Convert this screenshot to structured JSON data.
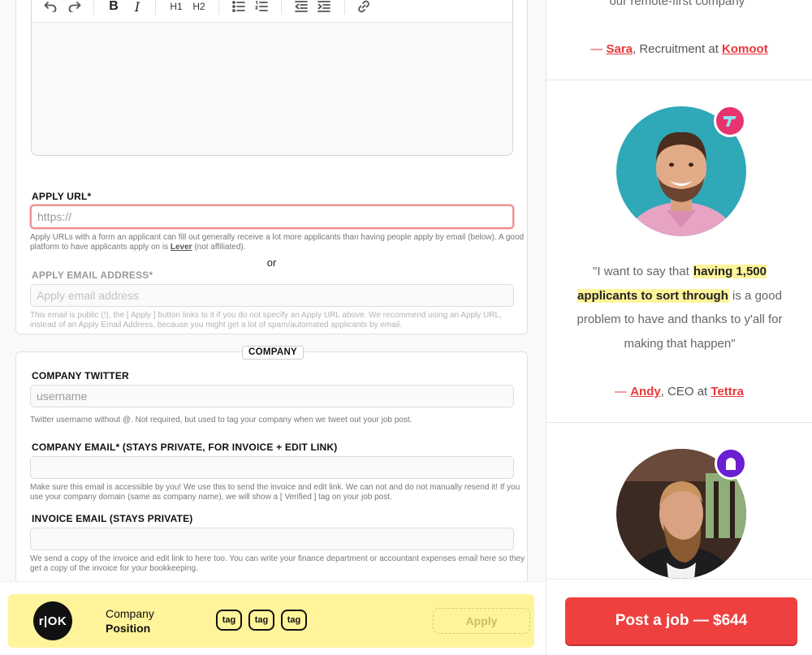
{
  "editor": {
    "toolbar": {
      "h1": "H1",
      "h2": "H2"
    }
  },
  "apply_url": {
    "label": "APPLY URL*",
    "placeholder": "https://",
    "help_pre": "Apply URLs with a form an applicant can fill out generally receive a lot more applicants than having people apply by email (below). A good platform to have applicants apply on is ",
    "help_link": "Lever",
    "help_post": " (not affiliated)."
  },
  "or_text": "or",
  "apply_email": {
    "label": "APPLY EMAIL ADDRESS*",
    "placeholder": "Apply email address",
    "help": "This email is public (!), the [ Apply ] button links to it if you do not specify an Apply URL above. We recommend using an Apply URL, instead of an Apply Email Address, because you might get a lot of spam/automated applicants by email."
  },
  "company_section": {
    "legend": "COMPANY",
    "twitter": {
      "label": "COMPANY TWITTER",
      "placeholder": "username",
      "help": "Twitter username without @. Not required, but used to tag your company when we tweet out your job post."
    },
    "email": {
      "label": "COMPANY EMAIL* (STAYS PRIVATE, FOR INVOICE + EDIT LINK)",
      "value": "",
      "help": "Make sure this email is accessible by you! We use this to send the invoice and edit link. We can not and do not manually resend it! If you use your company domain (same as company name), we will show a [ Verified ] tag on your job post."
    },
    "invoice": {
      "label": "INVOICE EMAIL (STAYS PRIVATE)",
      "value": "",
      "help": "We send a copy of the invoice and edit link to here too. You can write your finance department or accountant expenses email here so they get a copy of the invoice for your bookkeeping."
    }
  },
  "preview": {
    "logo_text": "r|OK",
    "company": "Company",
    "position": "Position",
    "tags": [
      "tag",
      "tag",
      "tag"
    ],
    "apply_label": "Apply",
    "color": "#fff49a"
  },
  "testimonials": [
    {
      "quote_tail": "our remote-first company\"",
      "dash": "— ",
      "name": "Sara",
      "role": ", Recruitment at ",
      "company": "Komoot"
    },
    {
      "quote_open": "\"I want to say that ",
      "quote_highlight": "having 1,500 applicants to sort through",
      "quote_close": " is a good problem to have and thanks to y'all for making that happen\"",
      "dash": "— ",
      "name": "Andy",
      "role": ", CEO at ",
      "company": "Tettra",
      "badge_color": "#e8336d"
    },
    {
      "badge_color": "#6a1fd1"
    }
  ],
  "post_button": {
    "label": "Post a job — $644",
    "color": "#ef4040"
  },
  "colors": {
    "accent": "#e8393a",
    "highlight": "#fff49a",
    "focus_border": "#ec8f90"
  }
}
